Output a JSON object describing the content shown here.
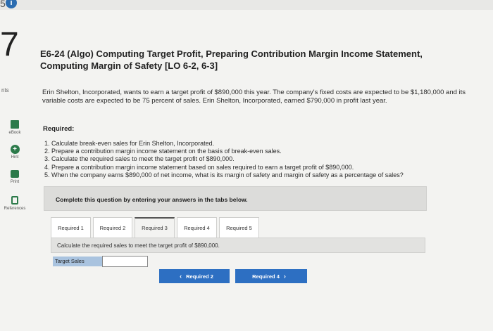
{
  "header": {
    "question_number_fragment": "5",
    "info_icon": "info-icon"
  },
  "question_number": "7",
  "sidebar": {
    "pts_label": "nts",
    "items": [
      {
        "icon": "ebook-icon",
        "label": "eBook"
      },
      {
        "icon": "hint-icon",
        "label": "Hint"
      },
      {
        "icon": "print-icon",
        "label": "Print"
      },
      {
        "icon": "references-icon",
        "label": "References"
      }
    ]
  },
  "problem": {
    "title": "E6-24 (Algo) Computing Target Profit, Preparing Contribution Margin Income Statement, Computing Margin of Safety [LO 6-2, 6-3]",
    "intro": "Erin Shelton, Incorporated, wants to earn a target profit of $890,000 this year. The company's fixed costs are expected to be $1,180,000 and its variable costs are expected to be 75 percent of sales. Erin Shelton, Incorporated, earned $790,000 in profit last year.",
    "required_heading": "Required:",
    "requirements": [
      "1. Calculate break-even sales for Erin Shelton, Incorporated.",
      "2. Prepare a contribution margin income statement on the basis of break-even sales.",
      "3. Calculate the required sales to meet the target profit of $890,000.",
      "4. Prepare a contribution margin income statement based on sales required to earn a target profit of $890,000.",
      "5. When the company earns $890,000 of net income, what is its margin of safety and margin of safety as a percentage of sales?"
    ]
  },
  "instructions": "Complete this question by entering your answers in the tabs below.",
  "tabs": [
    {
      "label": "Required 1"
    },
    {
      "label": "Required 2"
    },
    {
      "label": "Required 3",
      "active": true
    },
    {
      "label": "Required 4"
    },
    {
      "label": "Required 5"
    }
  ],
  "panel": {
    "prompt": "Calculate the required sales to meet the target profit of $890,000.",
    "field_label": "Target Sales",
    "field_value": ""
  },
  "nav": {
    "prev_label": "Required 2",
    "next_label": "Required 4"
  },
  "colors": {
    "button_blue": "#2d6fc2",
    "icon_green": "#2c7a4a",
    "label_blue": "#a9c3df"
  }
}
